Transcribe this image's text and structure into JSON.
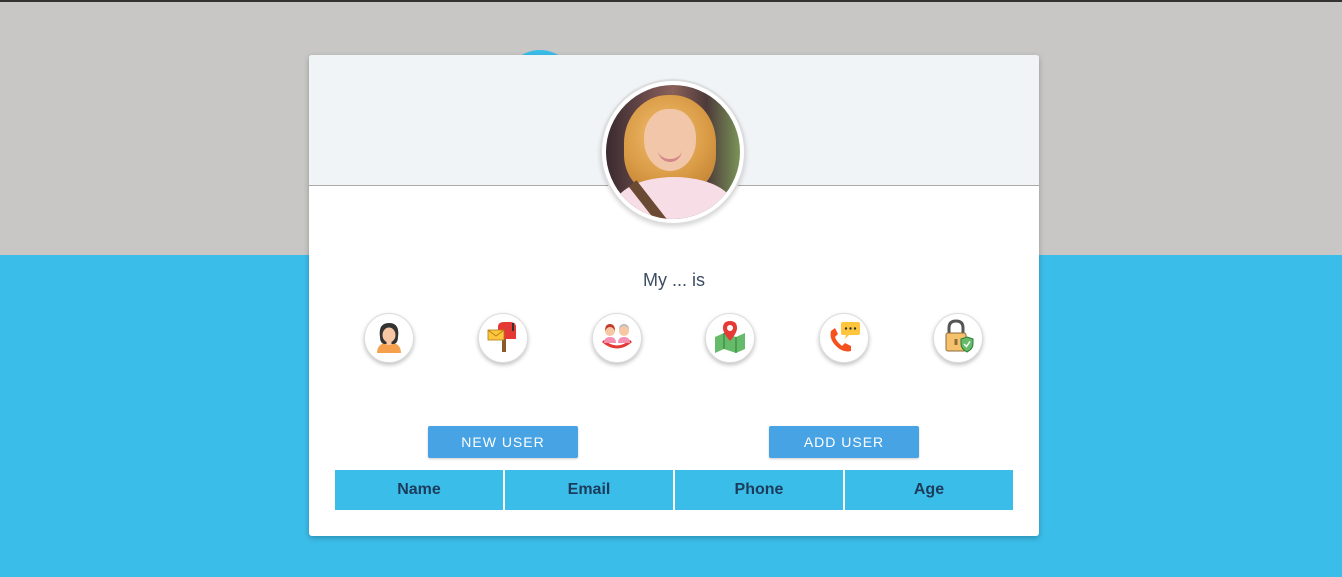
{
  "prompt": "My ... is",
  "attributes": [
    {
      "icon": "woman-icon",
      "label": "name"
    },
    {
      "icon": "mailbox-icon",
      "label": "email"
    },
    {
      "icon": "people-icon",
      "label": "age"
    },
    {
      "icon": "map-icon",
      "label": "address"
    },
    {
      "icon": "phone-icon",
      "label": "phone"
    },
    {
      "icon": "lock-icon",
      "label": "password"
    }
  ],
  "buttons": {
    "new_user": "NEW USER",
    "add_user": "ADD USER"
  },
  "table": {
    "columns": [
      "Name",
      "Email",
      "Phone",
      "Age"
    ]
  },
  "colors": {
    "accent": "#47a3e4",
    "background_blue": "#3bbde9",
    "background_gray": "#c8c7c6"
  }
}
